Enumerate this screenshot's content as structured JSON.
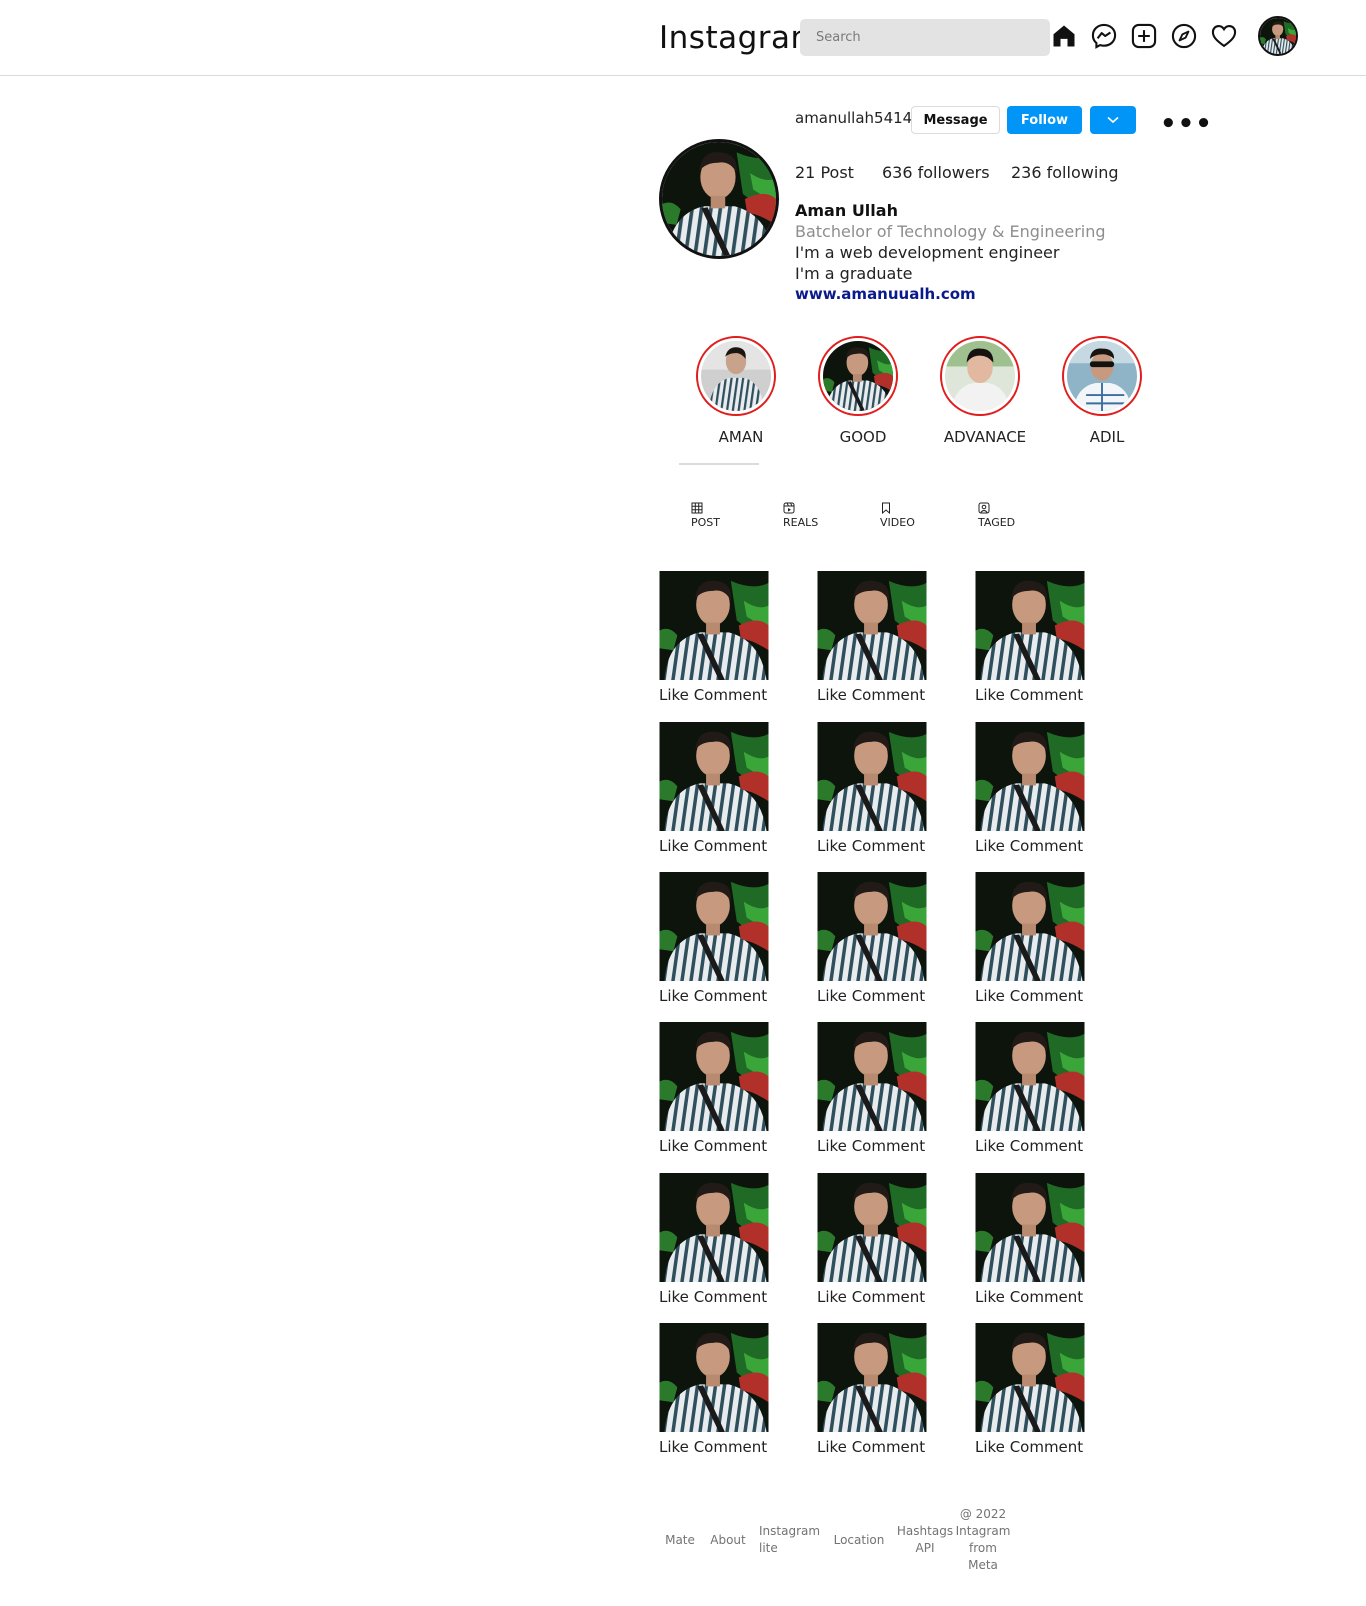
{
  "header": {
    "brand": "Instagram",
    "search_placeholder": "Search",
    "icons": [
      "home-icon",
      "messenger-icon",
      "new-post-icon",
      "explore-icon",
      "heart-icon"
    ]
  },
  "profile": {
    "username": "amanullah5414",
    "message_label": "Message",
    "follow_label": "Follow",
    "more_label": "•••",
    "posts": "21 Post",
    "followers": "636 followers",
    "following": "236 following",
    "full_name": "Aman Ullah",
    "category": "Batchelor of Technology & Engineering",
    "bio_line1": "I'm a web development engineer",
    "bio_line2": "I'm a graduate",
    "website": "www.amanuualh.com"
  },
  "highlights": [
    {
      "label": "AMAN"
    },
    {
      "label": "GOOD"
    },
    {
      "label": "ADVANACE"
    },
    {
      "label": "ADIL"
    }
  ],
  "tabs": [
    {
      "label": "POST",
      "icon": "grid-icon"
    },
    {
      "label": "REALS",
      "icon": "reels-icon"
    },
    {
      "label": "VIDEO",
      "icon": "bookmark-icon"
    },
    {
      "label": "TAGED",
      "icon": "tagged-icon"
    }
  ],
  "post_actions": {
    "like": "Like",
    "comment": "Comment"
  },
  "footer": {
    "mate": "Mate",
    "about": "About",
    "instagram_lite": "Instagram lite",
    "location": "Location",
    "hashtags_api": "Hashtags API",
    "copyright": "@ 2022 Intagram from Meta"
  },
  "colors": {
    "follow_button": "#0095f6",
    "highlight_ring": "#e01e1e",
    "link": "#0a1a8c",
    "muted_text": "#8e8e8e"
  }
}
